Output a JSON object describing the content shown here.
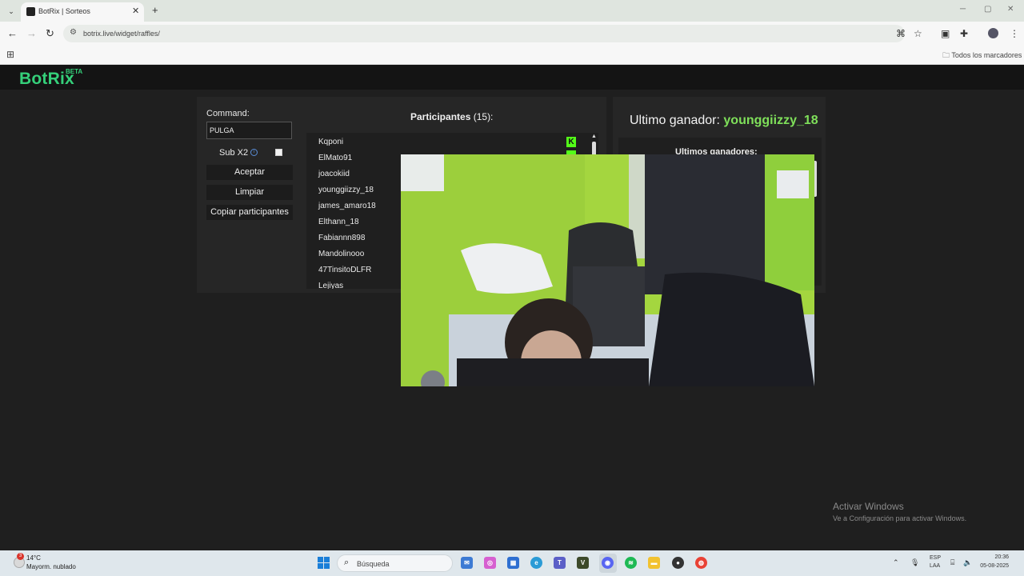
{
  "browser": {
    "tab_title": "BotRix | Sorteos",
    "url": "botrix.live/widget/raffles/",
    "bookmarks_label": "Todos los marcadores"
  },
  "app": {
    "logo": "BotRix",
    "logo_badge": "BETA"
  },
  "raffle": {
    "command_label": "Command:",
    "command_value": "PULGA",
    "sub_x2_label": "Sub X2",
    "sub_x2_checked": false,
    "accept_label": "Aceptar",
    "clear_label": "Limpiar",
    "copy_label": "Copiar participantes",
    "participants_title": "Participantes",
    "participants_count": "(15):",
    "participants": [
      "Kqponi",
      "ElMato91",
      "joacokiid",
      "younggiizzy_18",
      "james_amaro18",
      "Elthann_18",
      "Fabiannn898",
      "Mandolinooo",
      "47TinsitoDLFR",
      "Lejiyas"
    ]
  },
  "winners": {
    "last_winner_label": "Ultimo ganador:",
    "last_winner_name": "younggiizzy_18",
    "list_title": "Ultimos ganadores:"
  },
  "watermark": {
    "title": "Activar Windows",
    "subtitle": "Ve a Configuración para activar Windows."
  },
  "taskbar": {
    "temperature": "14°C",
    "weather": "Mayorm. nublado",
    "weather_badge": "3",
    "search_placeholder": "Búsqueda",
    "lang_1": "ESP",
    "lang_2": "LAA",
    "time": "20:36",
    "date": "05-08-2025"
  },
  "colors": {
    "accent_green": "#35d07a",
    "winner_green": "#7fe05a",
    "kick_green": "#53fc18"
  }
}
